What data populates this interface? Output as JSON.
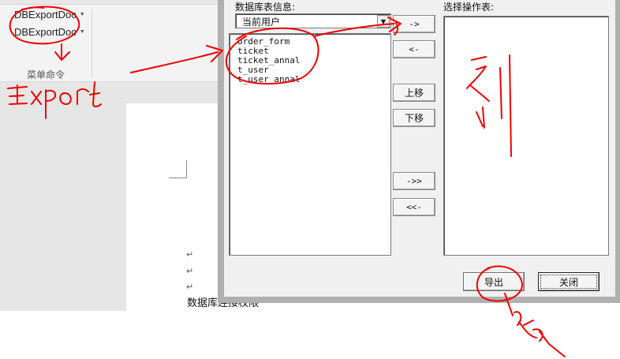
{
  "ribbon": {
    "buttons": [
      {
        "label": "DBExportDoc"
      },
      {
        "label": "DBExportDoc"
      }
    ],
    "group_label": "菜单命令"
  },
  "document": {
    "paragraph_marks": [
      "↵",
      "↵",
      "↵"
    ],
    "body_text": "数据库连接权限"
  },
  "dialog": {
    "db_tables_label": "数据库表信息:",
    "source_selector": {
      "value": "当前用户"
    },
    "db_tables": [
      "order_form",
      "ticket",
      "ticket_annal",
      "t_user",
      "t_user_annal"
    ],
    "selected_label": "选择操作表:",
    "selected_tables": [],
    "buttons": {
      "move_right": "->",
      "move_left": "<-",
      "move_up": "上移",
      "move_down": "下移",
      "move_all_right": "->>",
      "move_all_left": "<<-",
      "export": "导出",
      "close": "关闭"
    }
  },
  "annotations": {
    "ink_color": "#ee0000",
    "handwritten_labels": [
      "Export",
      "列",
      "导出"
    ]
  }
}
